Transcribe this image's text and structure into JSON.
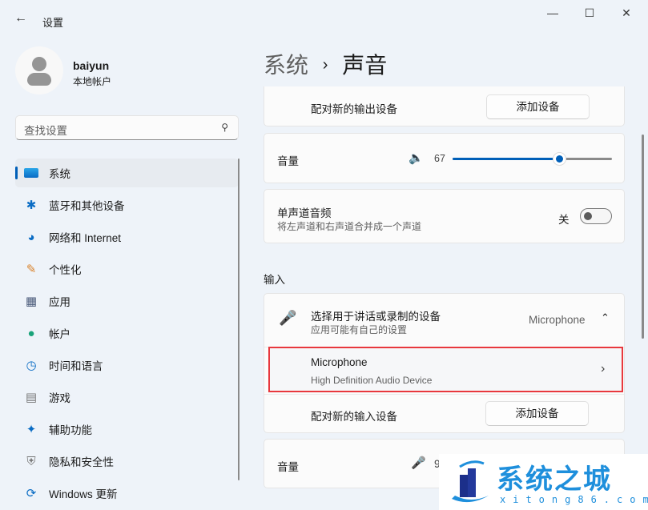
{
  "window": {
    "title": "设置",
    "back_icon": "arrow-left-icon",
    "minimize": "—",
    "maximize": "☐",
    "close": "✕"
  },
  "user": {
    "name": "baiyun",
    "type": "本地帐户"
  },
  "search": {
    "placeholder": "查找设置"
  },
  "nav": [
    {
      "label": "系统",
      "icon": "monitor-icon",
      "selected": true
    },
    {
      "label": "蓝牙和其他设备",
      "icon": "bluetooth-icon"
    },
    {
      "label": "网络和 Internet",
      "icon": "wifi-icon"
    },
    {
      "label": "个性化",
      "icon": "brush-icon"
    },
    {
      "label": "应用",
      "icon": "apps-icon"
    },
    {
      "label": "帐户",
      "icon": "person-icon"
    },
    {
      "label": "时间和语言",
      "icon": "globe-clock-icon"
    },
    {
      "label": "游戏",
      "icon": "gamepad-icon"
    },
    {
      "label": "辅助功能",
      "icon": "accessibility-icon"
    },
    {
      "label": "隐私和安全性",
      "icon": "shield-icon"
    },
    {
      "label": "Windows 更新",
      "icon": "update-icon"
    }
  ],
  "breadcrumb": {
    "parent": "系统",
    "sep": "›",
    "current": "声音"
  },
  "output": {
    "pair_label": "配对新的输出设备",
    "pair_button": "添加设备",
    "volume_label": "音量",
    "volume_value": "67",
    "volume_percent": 67,
    "mono_label": "单声道音频",
    "mono_desc": "将左声道和右声道合并成一个声道",
    "mono_state": "关"
  },
  "input": {
    "section": "输入",
    "choose_label": "选择用于讲话或录制的设备",
    "choose_desc": "应用可能有自己的设置",
    "choose_value": "Microphone",
    "device_name": "Microphone",
    "device_desc": "High Definition Audio Device",
    "pair_label": "配对新的输入设备",
    "pair_button": "添加设备",
    "volume_label": "音量",
    "volume_value": "9"
  },
  "watermark": {
    "text": "系统之城",
    "url": "xitong86.com"
  },
  "colors": {
    "accent": "#005fb8",
    "highlight": "#e8383d",
    "watermark": "#1e8fdc"
  }
}
